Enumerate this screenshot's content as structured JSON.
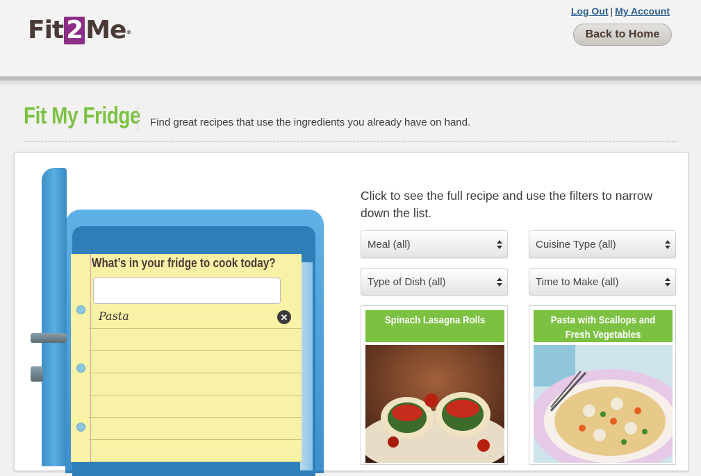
{
  "header": {
    "logo": {
      "part1": "Fit",
      "part2": "2",
      "part3": "Me",
      "tm": "®"
    },
    "logout_label": "Log Out",
    "separator": "|",
    "account_label": "My Account",
    "back_home_label": "Back to Home"
  },
  "page": {
    "title": "Fit My Fridge",
    "subtitle": "Find great recipes that use the ingredients you already have on hand."
  },
  "fridge": {
    "question": "What’s in your fridge to cook today?",
    "input_value": "",
    "ingredients": [
      "Pasta"
    ]
  },
  "results": {
    "instructions": "Click to see the full recipe and use the filters to narrow down the list.",
    "filters": {
      "meal": "Meal (all)",
      "cuisine": "Cuisine Type (all)",
      "dish": "Type of Dish (all)",
      "time": "Time to Make (all)"
    },
    "recipes": [
      {
        "title": "Spinach Lasagna Rolls"
      },
      {
        "title": "Pasta with Scallops and Fresh Vegetables"
      }
    ]
  },
  "colors": {
    "brand_green": "#7cc142",
    "brand_purple": "#8c2d86",
    "link_blue": "#2d5f8e",
    "fridge_blue": "#4a9fd8"
  }
}
